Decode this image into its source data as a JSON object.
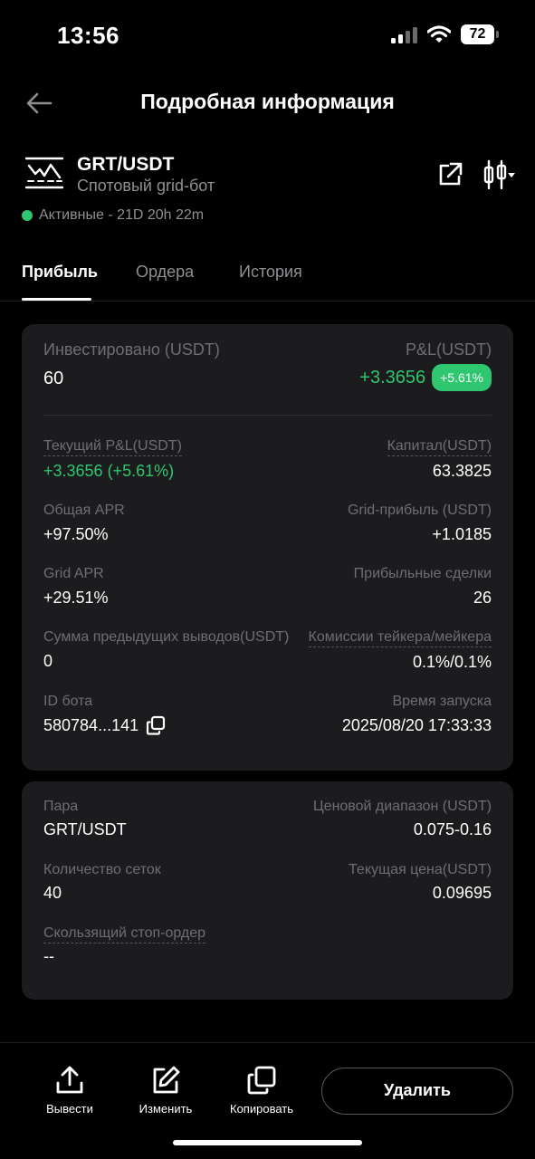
{
  "status_bar": {
    "time": "13:56",
    "battery": "72"
  },
  "header": {
    "title": "Подробная информация"
  },
  "bot": {
    "pair": "GRT/USDT",
    "type": "Спотовый grid-бот",
    "status": "Активные - 21D 20h 22m"
  },
  "tabs": [
    {
      "label": "Прибыль",
      "active": true
    },
    {
      "label": "Ордера",
      "active": false
    },
    {
      "label": "История",
      "active": false
    }
  ],
  "profit_card": {
    "invested_label": "Инвестировано (USDT)",
    "invested_value": "60",
    "pnl_label": "P&L(USDT)",
    "pnl_value": "+3.3656",
    "pnl_badge": "+5.61%",
    "current_pnl_label": "Текущий P&L(USDT)",
    "current_pnl_value": "+3.3656 (+5.61%)",
    "capital_label": "Капитал(USDT)",
    "capital_value": "63.3825",
    "total_apr_label": "Общая APR",
    "total_apr_value": "+97.50%",
    "grid_profit_label": "Grid-прибыль (USDT)",
    "grid_profit_value": "+1.0185",
    "grid_apr_label": "Grid APR",
    "grid_apr_value": "+29.51%",
    "profitable_trades_label": "Прибыльные сделки",
    "profitable_trades_value": "26",
    "withdrawals_label": "Сумма предыдущих выводов(USDT)",
    "withdrawals_value": "0",
    "fees_label": "Комиссии тейкера/мейкера",
    "fees_value": "0.1%/0.1%",
    "bot_id_label": "ID бота",
    "bot_id_value": "580784...141",
    "launch_time_label": "Время запуска",
    "launch_time_value": "2025/08/20 17:33:33"
  },
  "params_card": {
    "pair_label": "Пара",
    "pair_value": "GRT/USDT",
    "price_range_label": "Ценовой диапазон (USDT)",
    "price_range_value": "0.075-0.16",
    "grid_count_label": "Количество сеток",
    "grid_count_value": "40",
    "current_price_label": "Текущая цена(USDT)",
    "current_price_value": "0.09695",
    "trailing_stop_label": "Скользящий стоп-ордер",
    "trailing_stop_value": "--"
  },
  "bottom_bar": {
    "withdraw_label": "Вывести",
    "edit_label": "Изменить",
    "copy_label": "Копировать",
    "delete_label": "Удалить"
  },
  "colors": {
    "accent_green": "#2ec66e",
    "card_bg": "#1c1c1e",
    "muted_text": "#6e6e73"
  },
  "icons": [
    "back-arrow-icon",
    "grid-bot-icon",
    "share-icon",
    "candlestick-icon",
    "copy-icon",
    "upload-icon",
    "edit-icon",
    "duplicate-icon"
  ]
}
